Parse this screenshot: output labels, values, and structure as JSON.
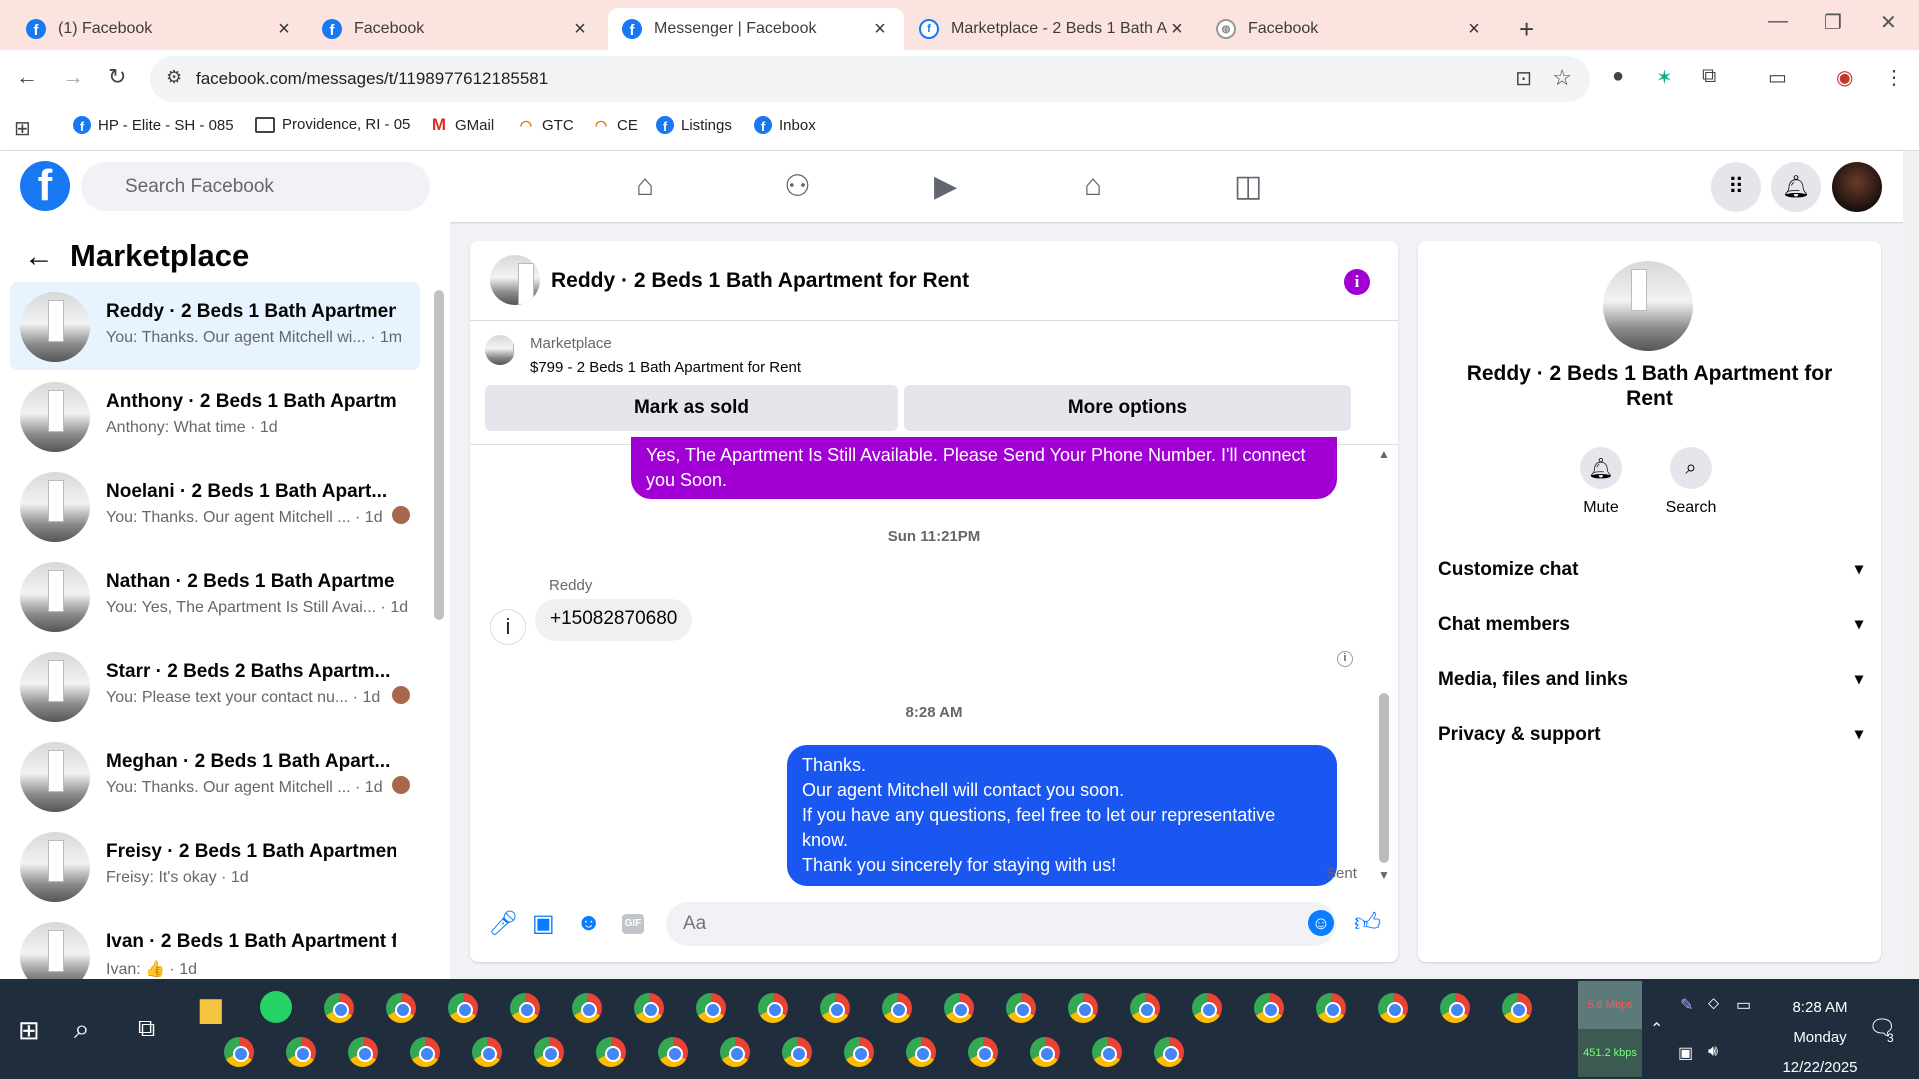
{
  "browser": {
    "tabs": [
      {
        "title": "(1) Facebook",
        "icon": "facebook-icon",
        "active": false
      },
      {
        "title": "Facebook",
        "icon": "facebook-icon",
        "active": false
      },
      {
        "title": "Messenger | Facebook",
        "icon": "facebook-icon",
        "active": true
      },
      {
        "title": "Marketplace - 2 Beds 1 Bath Ap",
        "icon": "marketplace-icon",
        "active": false
      },
      {
        "title": "Facebook",
        "icon": "globe-icon",
        "active": false
      }
    ],
    "url": "facebook.com/messages/t/1198977612185581",
    "bookmarks": [
      {
        "label": "HP - Elite - SH - 085",
        "icon": "facebook-icon"
      },
      {
        "label": "Providence, RI - 05",
        "icon": "folder-icon"
      },
      {
        "label": "GMail",
        "icon": "gmail-icon"
      },
      {
        "label": "GTC",
        "icon": "rainbow-icon"
      },
      {
        "label": "CE",
        "icon": "rainbow-icon"
      },
      {
        "label": "Listings",
        "icon": "facebook-icon"
      },
      {
        "label": "Inbox",
        "icon": "facebook-icon"
      }
    ]
  },
  "fb": {
    "search_placeholder": "Search Facebook",
    "brand_color": "#1877f2"
  },
  "sidebar": {
    "title": "Marketplace",
    "conversations": [
      {
        "name": "Reddy · 2 Beds 1 Bath Apartmen...",
        "preview": "You: Thanks. Our agent Mitchell wi... · 1m",
        "selected": true
      },
      {
        "name": "Anthony · 2 Beds 1 Bath Apartm...",
        "preview": "Anthony: What time · 1d",
        "selected": false
      },
      {
        "name": "Noelani · 2 Beds 1 Bath Apart...",
        "preview": "You: Thanks. Our agent Mitchell ... · 1d",
        "selected": false
      },
      {
        "name": "Nathan · 2 Beds 1 Bath Apartme...",
        "preview": "You: Yes, The Apartment Is Still Avai... · 1d",
        "selected": false
      },
      {
        "name": "Starr · 2 Beds 2 Baths Apartm...",
        "preview": "You: Please text your contact nu... · 1d",
        "selected": false
      },
      {
        "name": "Meghan · 2 Beds 1 Bath Apart...",
        "preview": "You: Thanks. Our agent Mitchell ... · 1d",
        "selected": false
      },
      {
        "name": "Freisy · 2 Beds 1 Bath Apartment...",
        "preview": "Freisy: It's okay · 1d",
        "selected": false
      },
      {
        "name": "Ivan · 2 Beds 1 Bath Apartment f...",
        "preview": "Ivan: 👍 · 1d",
        "selected": false
      }
    ]
  },
  "chat": {
    "title": "Reddy · 2 Beds 1 Bath Apartment for Rent",
    "marketplace_label": "Marketplace",
    "listing": "$799 - 2 Beds 1 Bath Apartment for Rent",
    "mark_sold": "Mark as sold",
    "more_options": "More options",
    "messages": {
      "msg1": "Yes, The Apartment Is Still Available. Please Send Your Phone Number. I'll connect you Soon.",
      "time1": "Sun 11:21PM",
      "sender": "Reddy",
      "phone": "+15082870680",
      "time2": "8:28 AM",
      "msg2_lines": [
        "Thanks.",
        "Our agent Mitchell will contact you soon.",
        "If you have any questions, feel free to let our representative know.",
        "Thank you sincerely for staying with us!"
      ],
      "status": "Sent"
    },
    "input_placeholder": "Aa",
    "gif_label": "GIF",
    "purple_bubble_color": "#a100d4",
    "blue_bubble_color": "#1a56f0"
  },
  "details": {
    "title": "Reddy · 2 Beds 1 Bath Apartment for Rent",
    "mute": "Mute",
    "search": "Search",
    "sections": [
      "Customize chat",
      "Chat members",
      "Media, files and links",
      "Privacy & support"
    ]
  },
  "taskbar": {
    "net_up": "5.6 Mbps",
    "net_down": "451.2 kbps",
    "time": "8:28 AM",
    "day": "Monday",
    "date": "12/22/2025",
    "notifications": "3"
  }
}
